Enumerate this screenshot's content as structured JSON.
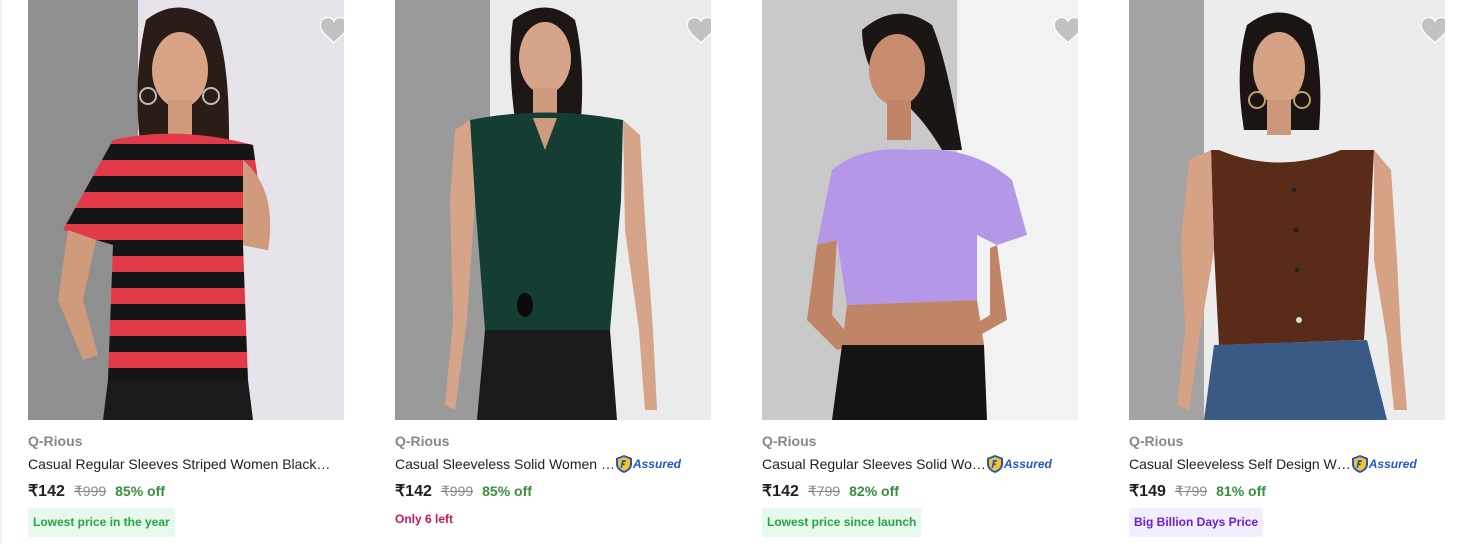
{
  "products": [
    {
      "brand": "Q-Rious",
      "title": "Casual Regular Sleeves Striped Women Black…",
      "assured": false,
      "assured_label": "",
      "price": "₹142",
      "mrp": "₹999",
      "discount": "85% off",
      "tag": "Lowest price in the year",
      "tag_style": "green",
      "image_desc": "model-red-black-striped-tshirt"
    },
    {
      "brand": "Q-Rious",
      "title": "Casual Sleeveless Solid Women …",
      "assured": true,
      "assured_label": "Assured",
      "price": "₹142",
      "mrp": "₹999",
      "discount": "85% off",
      "tag": "Only 6 left",
      "tag_style": "plain",
      "image_desc": "model-dark-green-sleeveless-top"
    },
    {
      "brand": "Q-Rious",
      "title": "Casual Regular Sleeves Solid Wo…",
      "assured": true,
      "assured_label": "Assured",
      "price": "₹142",
      "mrp": "₹799",
      "discount": "82% off",
      "tag": "Lowest price since launch",
      "tag_style": "green",
      "image_desc": "model-lavender-wrap-crop-top"
    },
    {
      "brand": "Q-Rious",
      "title": "Casual Sleeveless Self Design W…",
      "assured": true,
      "assured_label": "Assured",
      "price": "₹149",
      "mrp": "₹799",
      "discount": "81% off",
      "tag": "Big Billion Days Price",
      "tag_style": "purple",
      "image_desc": "model-brown-sleeveless-button-top"
    }
  ],
  "colors": {
    "wishlist_heart": "#c2c2c2",
    "discount": "#388e3c",
    "assured": "#2455c9"
  },
  "icons": {
    "wishlist": "heart-icon",
    "assured": "flipkart-assured-shield-icon"
  }
}
